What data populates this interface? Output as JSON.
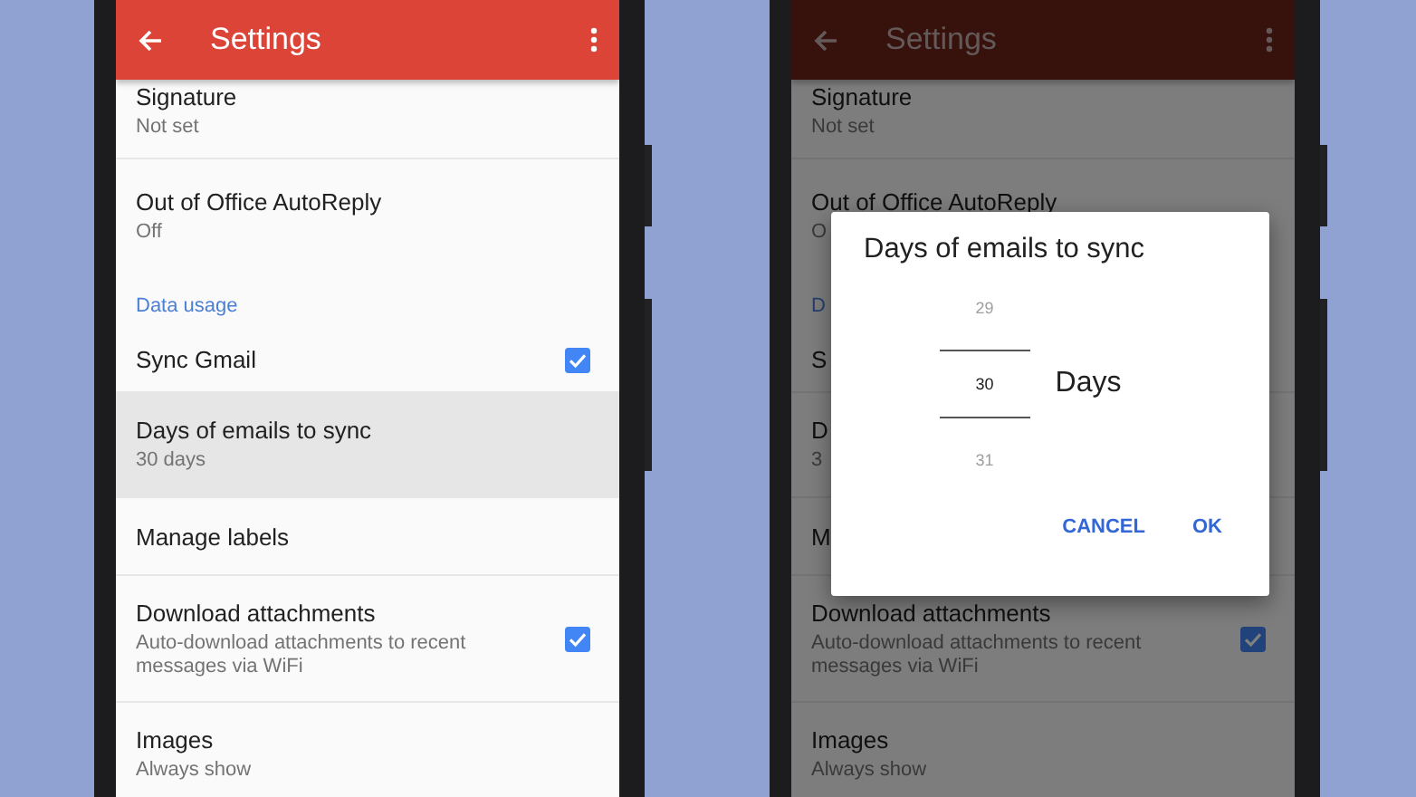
{
  "phones": [
    {
      "dimmed": false,
      "app_bar": {
        "title": "Settings"
      },
      "items": [
        {
          "kind": "setting",
          "title": "Signature",
          "subtitle": "Not set",
          "selected": false
        },
        {
          "kind": "setting",
          "title": "Out of Office AutoReply",
          "subtitle": "Off",
          "selected": false
        },
        {
          "kind": "section",
          "title": "Data usage"
        },
        {
          "kind": "setting",
          "title": "Sync Gmail",
          "checked": true,
          "selected": false
        },
        {
          "kind": "setting",
          "title": "Days of emails to sync",
          "subtitle": "30 days",
          "selected": true
        },
        {
          "kind": "setting",
          "title": "Manage labels",
          "selected": false
        },
        {
          "kind": "setting",
          "title": "Download attachments",
          "subtitle": "Auto-download attachments to recent messages via WiFi",
          "checked": true,
          "selected": false
        },
        {
          "kind": "setting",
          "title": "Images",
          "subtitle": "Always show",
          "selected": false
        }
      ]
    },
    {
      "dimmed": true,
      "app_bar": {
        "title": "Settings"
      },
      "items": [
        {
          "kind": "setting",
          "title": "Signature",
          "subtitle": "Not set"
        },
        {
          "kind": "setting",
          "title": "Out of Office AutoReply",
          "subtitle": "O"
        },
        {
          "kind": "section",
          "title": "D"
        },
        {
          "kind": "setting",
          "title": "S"
        },
        {
          "kind": "setting",
          "title": "D",
          "subtitle": "3"
        },
        {
          "kind": "setting",
          "title": "M"
        },
        {
          "kind": "setting",
          "title": "Download attachments",
          "subtitle": "Auto-download attachments to recent messages via WiFi",
          "checked": true
        },
        {
          "kind": "setting",
          "title": "Images",
          "subtitle": "Always show"
        }
      ],
      "dialog": {
        "title": "Days of emails to sync",
        "picker": {
          "options": [
            {
              "label": "29",
              "selected": false
            },
            {
              "label": "30",
              "selected": true
            },
            {
              "label": "31",
              "selected": false
            }
          ],
          "unit": "Days"
        },
        "buttons": [
          "CANCEL",
          "OK"
        ]
      }
    }
  ]
}
